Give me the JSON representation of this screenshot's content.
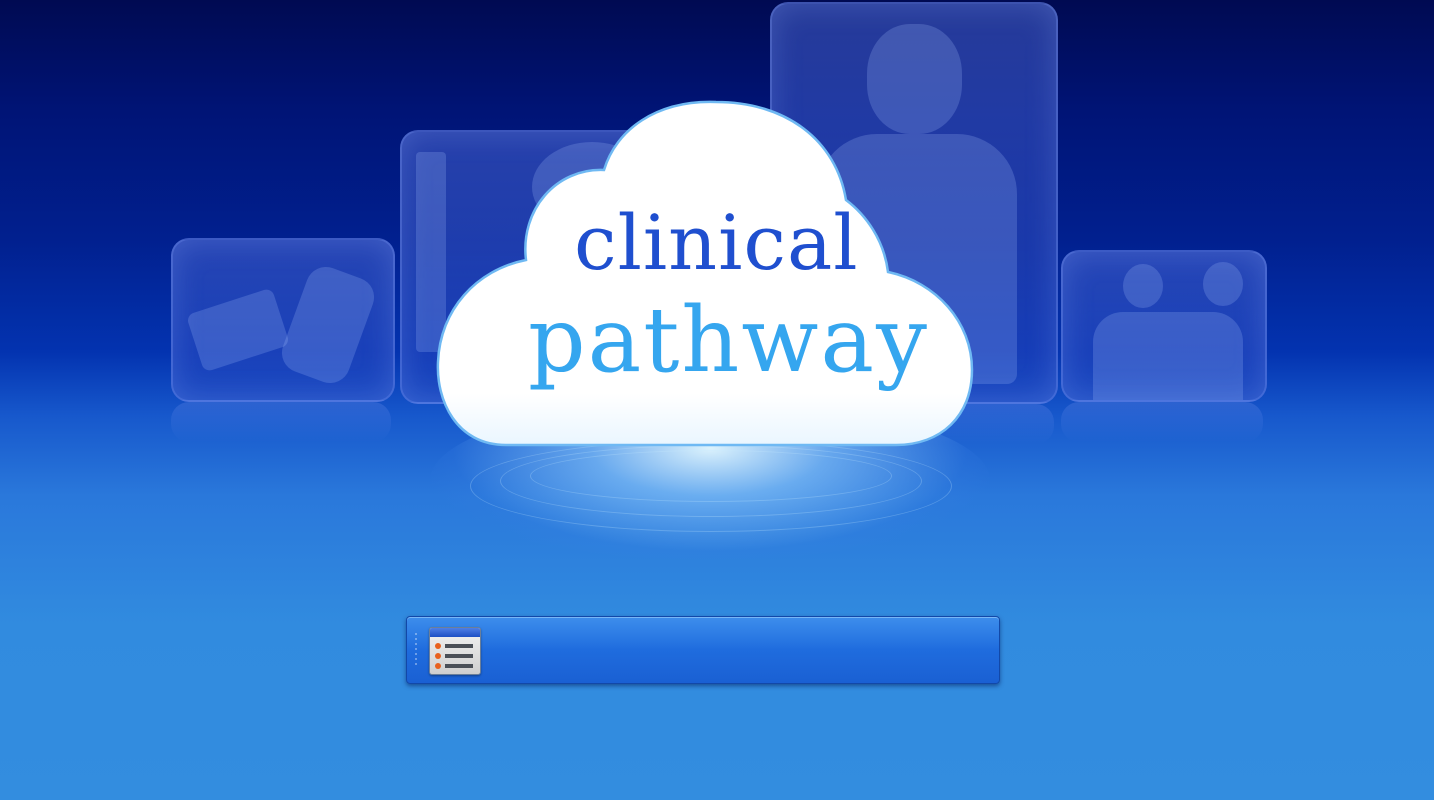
{
  "splash": {
    "title_line1": "clinical",
    "title_line2": "pathway"
  },
  "colors": {
    "title_line1": "#1f4fcf",
    "title_line2": "#35a6ef",
    "taskbar": "#1f6cde",
    "background_top": "#000a52",
    "background_bottom": "#338ddf"
  },
  "taskbar": {
    "icons": [
      "list-window-icon"
    ]
  }
}
